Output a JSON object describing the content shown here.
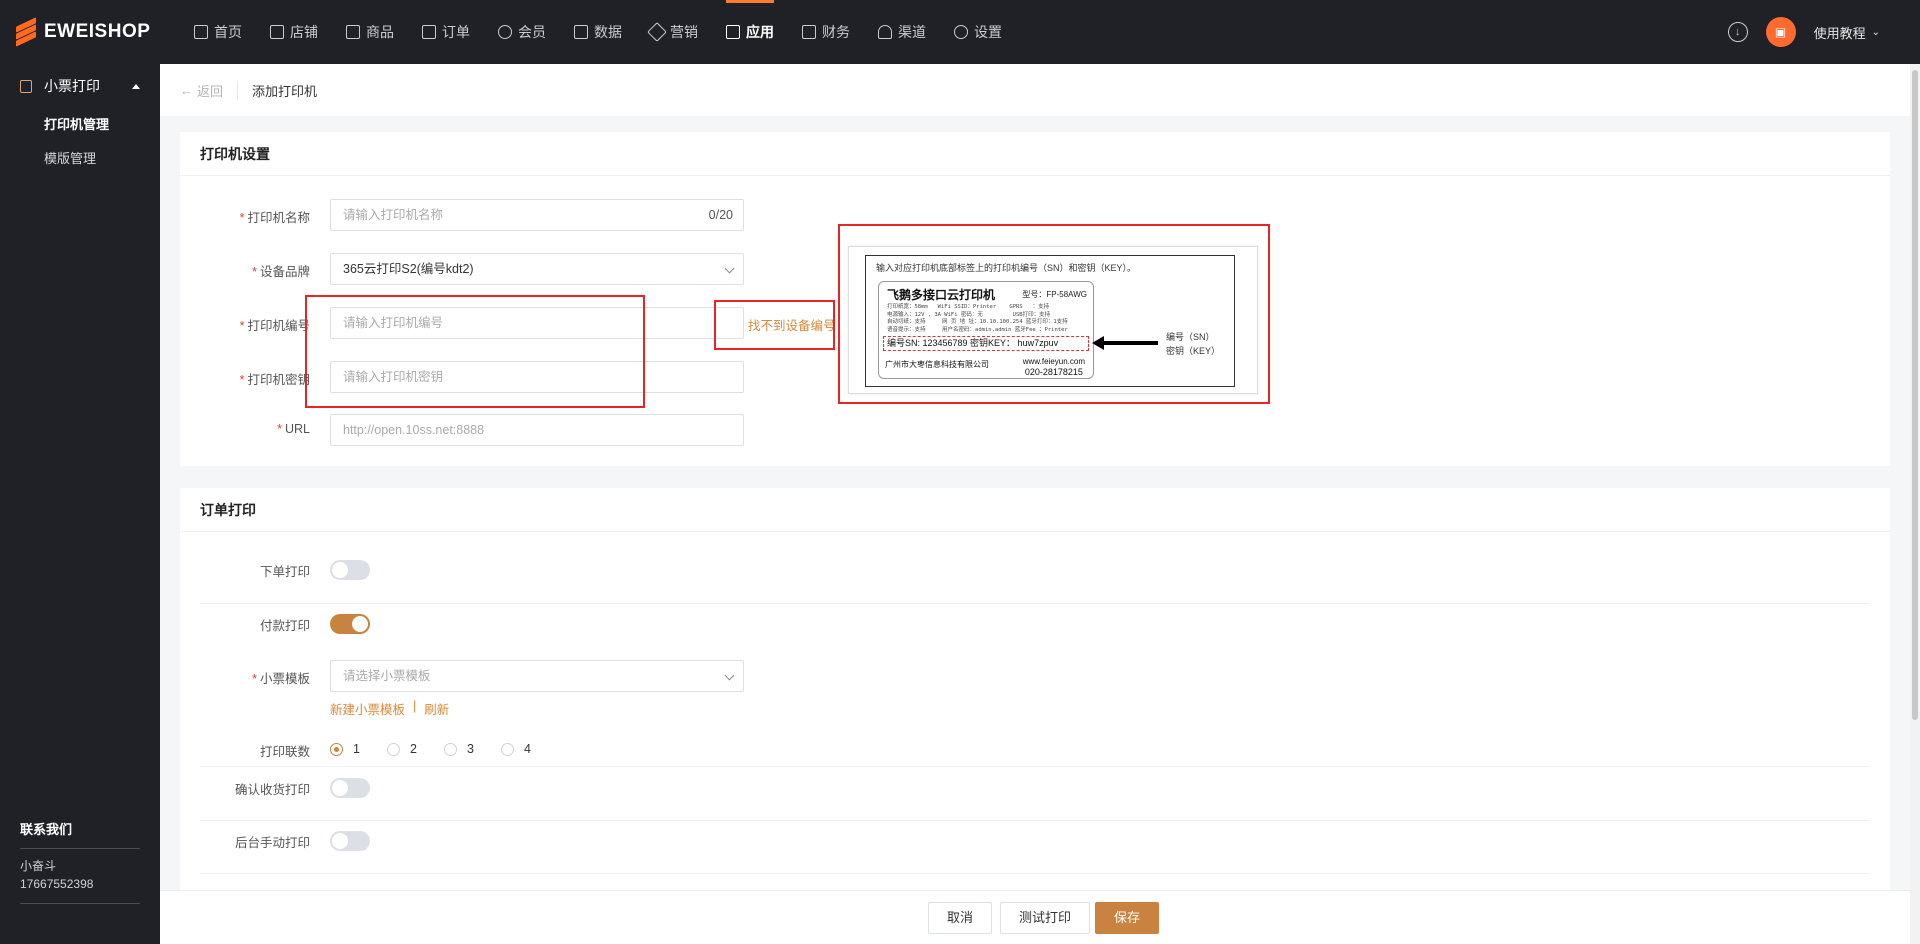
{
  "brand": {
    "name": "EWEISHOP"
  },
  "nav": {
    "items": [
      {
        "label": "首页",
        "icon": "home-icon"
      },
      {
        "label": "店铺",
        "icon": "store-icon"
      },
      {
        "label": "商品",
        "icon": "goods-icon"
      },
      {
        "label": "订单",
        "icon": "order-icon"
      },
      {
        "label": "会员",
        "icon": "member-icon"
      },
      {
        "label": "数据",
        "icon": "chart-icon"
      },
      {
        "label": "营销",
        "icon": "tag-icon"
      },
      {
        "label": "应用",
        "icon": "app-icon",
        "active": true
      },
      {
        "label": "财务",
        "icon": "finance-icon"
      },
      {
        "label": "渠道",
        "icon": "channel-icon"
      },
      {
        "label": "设置",
        "icon": "gear-icon"
      }
    ],
    "help_label": "使用教程"
  },
  "sidebar": {
    "group_label": "小票打印",
    "items": [
      {
        "label": "打印机管理",
        "active": true
      },
      {
        "label": "模版管理"
      }
    ],
    "contact": {
      "title": "联系我们",
      "name": "小奋斗",
      "phone": "17667552398"
    }
  },
  "breadcrumb": {
    "back": "返回",
    "current": "添加打印机"
  },
  "printer_settings": {
    "title": "打印机设置",
    "name": {
      "label": "打印机名称",
      "placeholder": "请输入打印机名称",
      "counter": "0/20"
    },
    "brand": {
      "label": "设备品牌",
      "value": "365云打印S2(编号kdt2)"
    },
    "sn": {
      "label": "打印机编号",
      "placeholder": "请输入打印机编号",
      "help_link": "找不到设备编号"
    },
    "key": {
      "label": "打印机密钥",
      "placeholder": "请输入打印机密钥"
    },
    "url": {
      "label": "URL",
      "placeholder": "http://open.10ss.net:8888"
    }
  },
  "illustration": {
    "instruction": "输入对应打印机底部标签上的打印机编号（SN）和密钥（KEY）。",
    "title": "飞鹅多接口云打印机",
    "model": "型号：FP-58AWG",
    "specs": "打印纸宽：58mm   WiFi SSID：Printer    GPRS   ：支持\n电源输入：12V , 3A WiFi 密码：无         USB打印：支持\n自动切纸：支持     网 页 地 址：10.10.100.254 蓝牙打印：1支持\n语音提示：支持     用户名密码：admin,admin 蓝牙Fee ：Printer",
    "sn_line": "编号SN:  123456789     密钥KEY： huw7zpuv",
    "company": "广州市大枣信息科技有限公司",
    "website": "www.feieyun.com",
    "phone": "020-28178215",
    "arrow_label_sn": "编号（SN）",
    "arrow_label_key": "密钥（KEY）"
  },
  "order_print": {
    "title": "订单打印",
    "place_order": {
      "label": "下单打印",
      "on": false
    },
    "payment": {
      "label": "付款打印",
      "on": true
    },
    "template": {
      "label": "小票模板",
      "placeholder": "请选择小票模板",
      "new_link": "新建小票模板",
      "separator": "|",
      "refresh_link": "刷新"
    },
    "copies": {
      "label": "打印联数",
      "options": [
        "1",
        "2",
        "3",
        "4"
      ],
      "selected": "1"
    },
    "confirm_receipt": {
      "label": "确认收货打印",
      "on": false
    },
    "manual": {
      "label": "后台手动打印",
      "on": false
    }
  },
  "footer": {
    "cancel": "取消",
    "test": "测试打印",
    "save": "保存"
  },
  "colors": {
    "accent": "#c9823f",
    "brand": "#ff6a1f",
    "highlight_box": "#e82424"
  }
}
